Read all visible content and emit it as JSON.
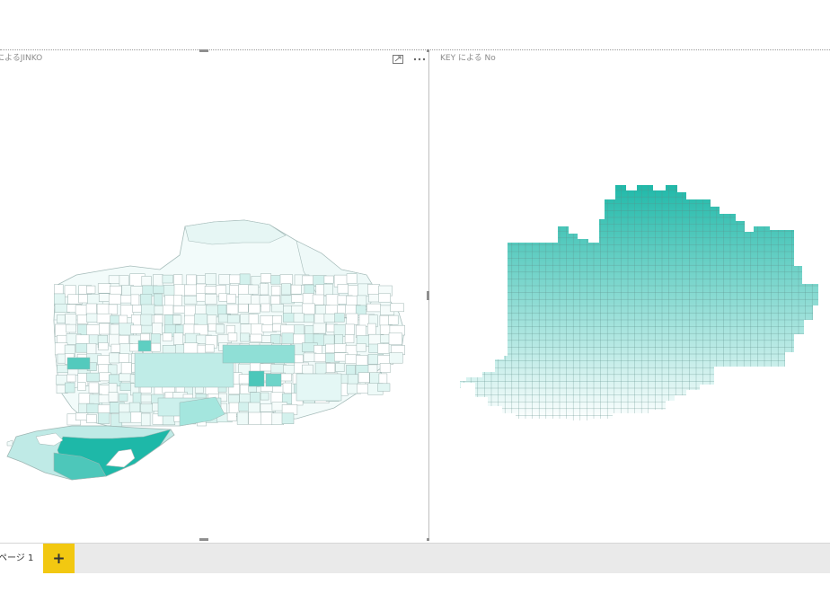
{
  "visuals": {
    "left": {
      "title": "によるJINKO",
      "focus_icon": "focus-mode-icon",
      "more_icon": "more-options-icon"
    },
    "right": {
      "title": "KEY による No"
    }
  },
  "tabs": [
    {
      "label": "ページ 1",
      "active": true
    }
  ],
  "add_tab": {
    "label": "+"
  },
  "colors": {
    "accent": "#1eb8a8",
    "tab_add": "#f2c811",
    "map_stroke": "#9fb6b3",
    "grid_stroke": "#5f8f8a"
  },
  "map_left": {
    "shading": "JINKO"
  },
  "map_right": {
    "shading": "No"
  }
}
